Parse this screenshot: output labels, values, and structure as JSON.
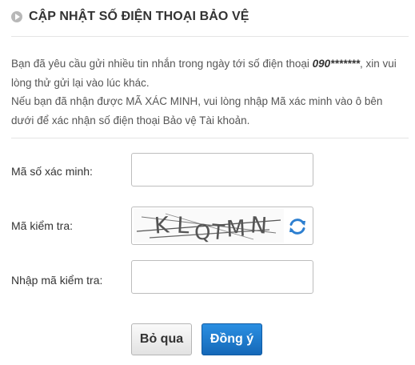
{
  "header": {
    "title": "CẬP NHẬT SỐ ĐIỆN THOẠI BẢO VỆ",
    "icon": "play-circle-icon"
  },
  "message": {
    "line1_prefix": "Bạn đã yêu cầu gửi nhiều tin nhắn trong ngày tới số điện thoại ",
    "phone": "090*******",
    "line1_suffix": ", xin vui lòng thử gửi lại vào lúc khác.",
    "line2": "Nếu bạn đã nhận được MÃ XÁC MINH, vui lòng nhập Mã xác minh vào ô bên dưới để xác nhận số điện thoại Bảo vệ Tài khoản."
  },
  "form": {
    "verification_code_label": "Mã số xác minh:",
    "verification_code_value": "",
    "captcha_label": "Mã kiểm tra:",
    "captcha_text": "KLQTMN",
    "captcha_refresh_icon": "refresh-icon",
    "captcha_input_label": "Nhập mã kiểm tra:",
    "captcha_input_value": ""
  },
  "buttons": {
    "skip_label": "Bỏ qua",
    "submit_label": "Đồng ý"
  },
  "colors": {
    "accent": "#1f7fd6",
    "refresh": "#2d7fd0"
  }
}
